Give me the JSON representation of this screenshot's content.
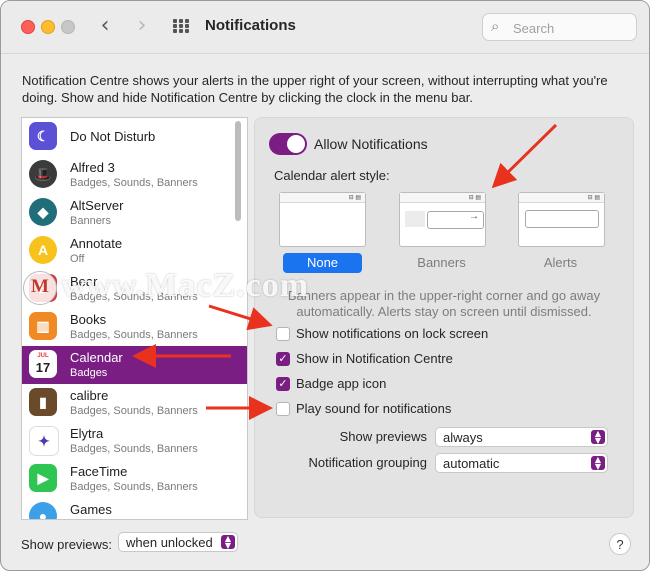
{
  "window": {
    "title": "Notifications",
    "back_icon": "chevron-left-icon",
    "forward_icon": "chevron-right-icon",
    "grid_icon": "grid-icon",
    "search_placeholder": "Search"
  },
  "description": "Notification Centre shows your alerts in the upper right of your screen, without interrupting what you're doing. Show and hide Notification Centre by clicking the clock in the menu bar.",
  "apps": [
    {
      "name": "Do Not Disturb",
      "subtitle": ""
    },
    {
      "name": "Alfred 3",
      "subtitle": "Badges, Sounds, Banners"
    },
    {
      "name": "AltServer",
      "subtitle": "Banners"
    },
    {
      "name": "Annotate",
      "subtitle": "Off"
    },
    {
      "name": "Bear",
      "subtitle": "Badges, Sounds, Banners"
    },
    {
      "name": "Books",
      "subtitle": "Badges, Sounds, Banners"
    },
    {
      "name": "Calendar",
      "subtitle": "Badges",
      "selected": true
    },
    {
      "name": "calibre",
      "subtitle": "Badges, Sounds, Banners"
    },
    {
      "name": "Elytra",
      "subtitle": "Badges, Sounds, Banners"
    },
    {
      "name": "FaceTime",
      "subtitle": "Badges, Sounds, Banners"
    },
    {
      "name": "Games",
      "subtitle": ""
    }
  ],
  "settings": {
    "allow_label": "Allow Notifications",
    "allow_on": true,
    "alert_style_label": "Calendar alert style:",
    "styles": [
      "None",
      "Banners",
      "Alerts"
    ],
    "selected_style": "None",
    "banner_note": "Banners appear in the upper-right corner and go away automatically. Alerts stay on screen until dismissed.",
    "checkboxes": [
      {
        "label": "Show notifications on lock screen",
        "checked": false
      },
      {
        "label": "Show in Notification Centre",
        "checked": true
      },
      {
        "label": "Badge app icon",
        "checked": true
      },
      {
        "label": "Play sound for notifications",
        "checked": false
      }
    ],
    "show_previews_label": "Show previews",
    "show_previews_value": "always",
    "grouping_label": "Notification grouping",
    "grouping_value": "automatic"
  },
  "bottom": {
    "show_previews_label": "Show previews:",
    "show_previews_value": "when unlocked",
    "help": "?"
  },
  "watermark": {
    "text": "www.MacZ.com",
    "logo_letter": "M"
  },
  "colors": {
    "accent": "#7a1e84",
    "selected_style": "#1a74f0",
    "annotation_arrow": "#e8321e"
  }
}
